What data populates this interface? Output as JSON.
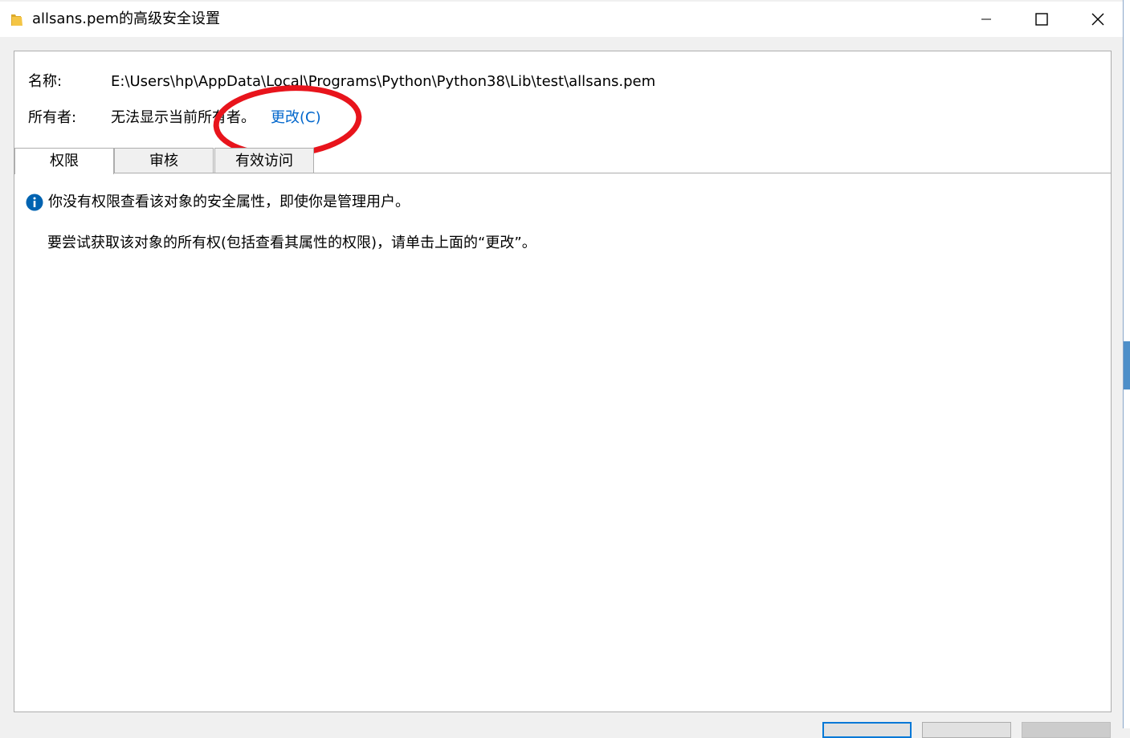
{
  "window": {
    "title": "allsans.pem的高级安全设置",
    "controls": {
      "minimize_icon": "minimize-icon",
      "maximize_icon": "maximize-icon",
      "close_icon": "close-icon"
    }
  },
  "name_row": {
    "label": "名称:",
    "value": "E:\\Users\\hp\\AppData\\Local\\Programs\\Python\\Python38\\Lib\\test\\allsans.pem"
  },
  "owner_row": {
    "label": "所有者:",
    "value": "无法显示当前所有者。",
    "change_link": "更改(C)"
  },
  "tabs": [
    {
      "label": "权限",
      "selected": true
    },
    {
      "label": "审核",
      "selected": false
    },
    {
      "label": "有效访问",
      "selected": false
    }
  ],
  "content": {
    "info_icon": "info-icon",
    "info_message": "你没有权限查看该对象的安全属性，即使你是管理用户。",
    "hint_message": "要尝试获取该对象的所有权(包括查看其属性的权限)，请单击上面的“更改”。"
  },
  "colors": {
    "link": "#0066cc",
    "annotation": "#e8141c",
    "info_icon": "#0063b1",
    "folder_icon": "#f4c545"
  }
}
